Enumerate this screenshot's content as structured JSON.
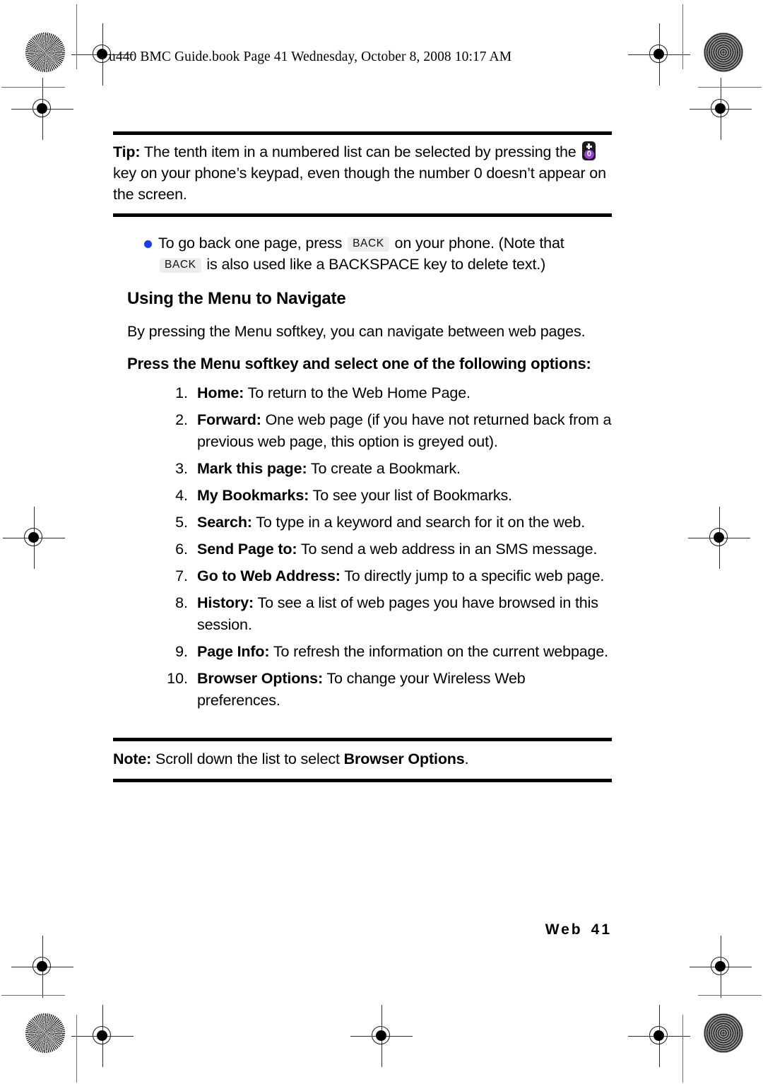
{
  "header": {
    "running_head": "u440 BMC Guide.book  Page 41  Wednesday, October 8, 2008  10:17 AM"
  },
  "tip_callout": {
    "label": "Tip:",
    "text_before_key": " The tenth item in a numbered list can be selected by pressing the ",
    "key_icon": "zero-plus-key-icon",
    "key_plus": "+",
    "key_digit": "0",
    "text_after_key": " key on your phone’s keypad, even though the number 0 doesn’t appear on the screen."
  },
  "bullet": {
    "icon": "bullet-dot-icon",
    "part1": "To go back one page, press ",
    "key1": "BACK",
    "part2": " on your phone. (Note that ",
    "key2": "BACK",
    "part3": " is also used like a BACKSPACE key to delete text.)"
  },
  "section": {
    "heading": "Using the Menu to Navigate",
    "intro": "By pressing the Menu softkey, you can navigate between web pages.",
    "subheading": "Press the Menu softkey and select one of the following options:"
  },
  "options": [
    {
      "num": "1.",
      "term": "Home:",
      "desc": " To return to the Web Home Page."
    },
    {
      "num": "2.",
      "term": "Forward:",
      "desc": " One web page (if you have not returned back from a previous web page, this option is greyed out)."
    },
    {
      "num": "3.",
      "term": "Mark this page:",
      "desc": " To create a Bookmark."
    },
    {
      "num": "4.",
      "term": "My Bookmarks:",
      "desc": " To see your list of Bookmarks."
    },
    {
      "num": "5.",
      "term": "Search:",
      "desc": " To type in a keyword and search for it on the web."
    },
    {
      "num": "6.",
      "term": "Send Page to:",
      "desc": " To send a web address in an SMS message."
    },
    {
      "num": "7.",
      "term": "Go to Web Address:",
      "desc": " To directly jump to a specific web page."
    },
    {
      "num": "8.",
      "term": "History:",
      "desc": " To see a list of web pages you have browsed in this session."
    },
    {
      "num": "9.",
      "term": "Page Info:",
      "desc": " To refresh the information on the current webpage."
    },
    {
      "num": "10.",
      "term": "Browser Options:",
      "desc": " To change your Wireless Web preferences."
    }
  ],
  "note_callout": {
    "label": "Note:",
    "text_before": " Scroll down the list to select ",
    "emphasis": "Browser Options",
    "text_after": "."
  },
  "footer": {
    "chapter": "Web",
    "page_number": "41"
  },
  "colors": {
    "bullet_blue": "#1a3df0",
    "key_purple": "#9b3fd9",
    "key_body": "#1b1b20",
    "keytag_bg": "#eceded",
    "rule_black": "#000000"
  }
}
